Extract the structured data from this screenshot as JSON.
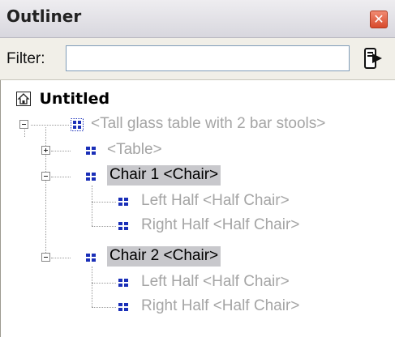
{
  "window": {
    "title": "Outliner",
    "close_glyph": "✕"
  },
  "filter": {
    "label": "Filter:",
    "value": "",
    "placeholder": ""
  },
  "tree": {
    "root_label": "Untitled",
    "nodes": [
      {
        "label": "<Tall glass table with 2 bar stools>",
        "state": "expanded",
        "selected": false
      },
      {
        "label": "<Table>",
        "state": "collapsed",
        "selected": false
      },
      {
        "label": "Chair 1 <Chair>",
        "state": "expanded",
        "selected": true
      },
      {
        "label": "Left Half <Half Chair>",
        "state": "leaf",
        "selected": false
      },
      {
        "label": "Right Half <Half Chair>",
        "state": "leaf",
        "selected": false
      },
      {
        "label": "Chair 2 <Chair>",
        "state": "expanded",
        "selected": true
      },
      {
        "label": "Left Half <Half Chair>",
        "state": "leaf",
        "selected": false
      },
      {
        "label": "Right Half <Half Chair>",
        "state": "leaf",
        "selected": false
      }
    ]
  },
  "colors": {
    "icon_blue": "#1a2fb8",
    "selection_bg": "#c8c8cc",
    "muted_text": "#a5a5a5"
  }
}
